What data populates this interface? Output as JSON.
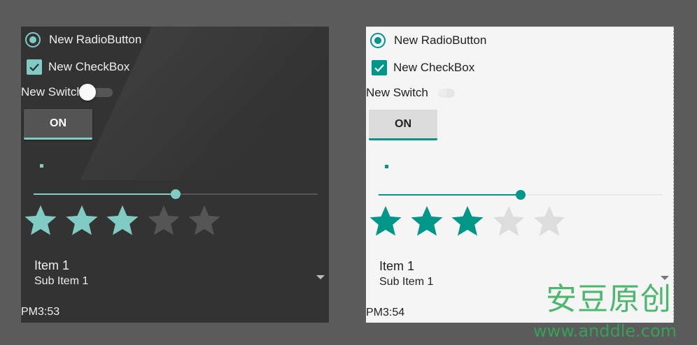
{
  "colors": {
    "accent": "#009688",
    "accent_light": "#80cbc4",
    "dark_bg": "#333333",
    "light_bg": "#f5f5f5",
    "window_bg": "#5b5b5b",
    "watermark": "#2eae57"
  },
  "dark": {
    "radio_label": "New RadioButton",
    "checkbox_label": "New CheckBox",
    "switch_label": "New Switch",
    "toggle_label": "ON",
    "seek_fraction": 0.5,
    "rating": 3,
    "rating_max": 5,
    "spinner_title": "Item 1",
    "spinner_subtitle": "Sub Item 1",
    "clock": "PM3:53"
  },
  "light": {
    "radio_label": "New RadioButton",
    "checkbox_label": "New CheckBox",
    "switch_label": "New Switch",
    "toggle_label": "ON",
    "seek_fraction": 0.5,
    "rating": 3,
    "rating_max": 5,
    "spinner_title": "Item 1",
    "spinner_subtitle": "Sub Item 1",
    "clock": "PM3:54"
  },
  "watermark": {
    "chinese": "安豆原创",
    "url": "www.anddle.com"
  }
}
